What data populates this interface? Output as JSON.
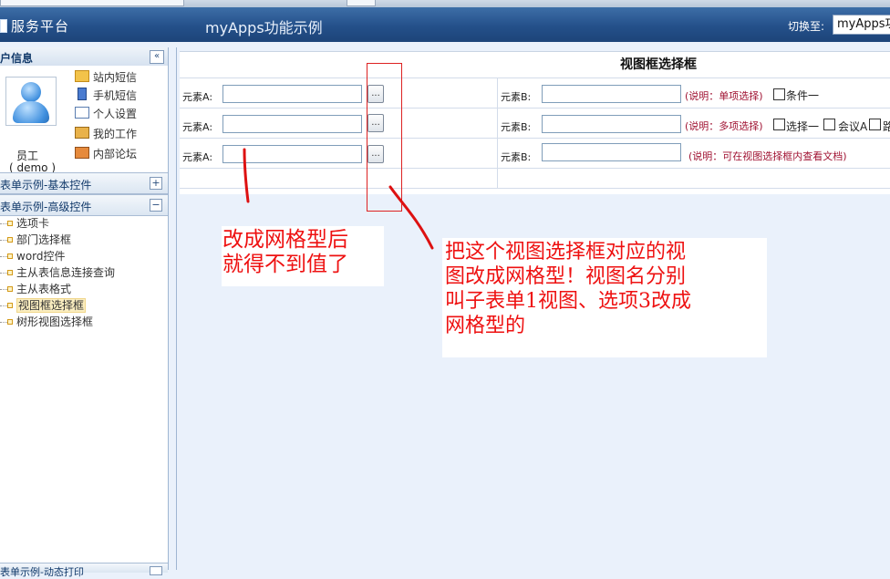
{
  "header": {
    "brand": "服务平台",
    "app_title": "myApps功能示例",
    "switch_label": "切换至:",
    "switch_value": "myApps功"
  },
  "sidebar": {
    "user_section_title": "户信息",
    "collapse": "«",
    "user": {
      "name": "员工",
      "id": "( demo )"
    },
    "user_menu": [
      "站内短信",
      "手机短信",
      "个人设置",
      "我的工作",
      "内部论坛"
    ],
    "sections": [
      {
        "title": "表单示例-基本控件",
        "toggle": "+"
      },
      {
        "title": "表单示例-高级控件",
        "toggle": "−"
      }
    ],
    "tree_items": [
      "选项卡",
      "部门选择框",
      "word控件",
      "主从表信息连接查询",
      "主从表格式",
      "视图框选择框",
      "树形视图选择框"
    ],
    "bottom_section": "表单示例-动态打印"
  },
  "form": {
    "title": "视图框选择框",
    "dots": "...",
    "rows": [
      {
        "label_a": "元素A:",
        "label_b": "元素B:",
        "note": "(说明：单项选择)",
        "options": [
          "条件一"
        ]
      },
      {
        "label_a": "元素A:",
        "label_b": "元素B:",
        "note": "(说明：多项选择)",
        "options": [
          "选择一",
          "会议A",
          "路"
        ]
      },
      {
        "label_a": "元素A:",
        "label_b": "元素B:",
        "note": "(说明：可在视图选择框内查看文档)",
        "options": []
      }
    ]
  },
  "annotations": {
    "left_note": [
      "改成网格型后",
      "就得不到值了"
    ],
    "right_note": [
      "把这个视图选择框对应的视",
      "图改成网格型！视图名分别",
      "叫子表单1视图、选项3改成",
      "网格型的"
    ]
  },
  "colors": {
    "header": "#24508a",
    "note_red": "#a01232",
    "annotation_red": "#e11111"
  }
}
